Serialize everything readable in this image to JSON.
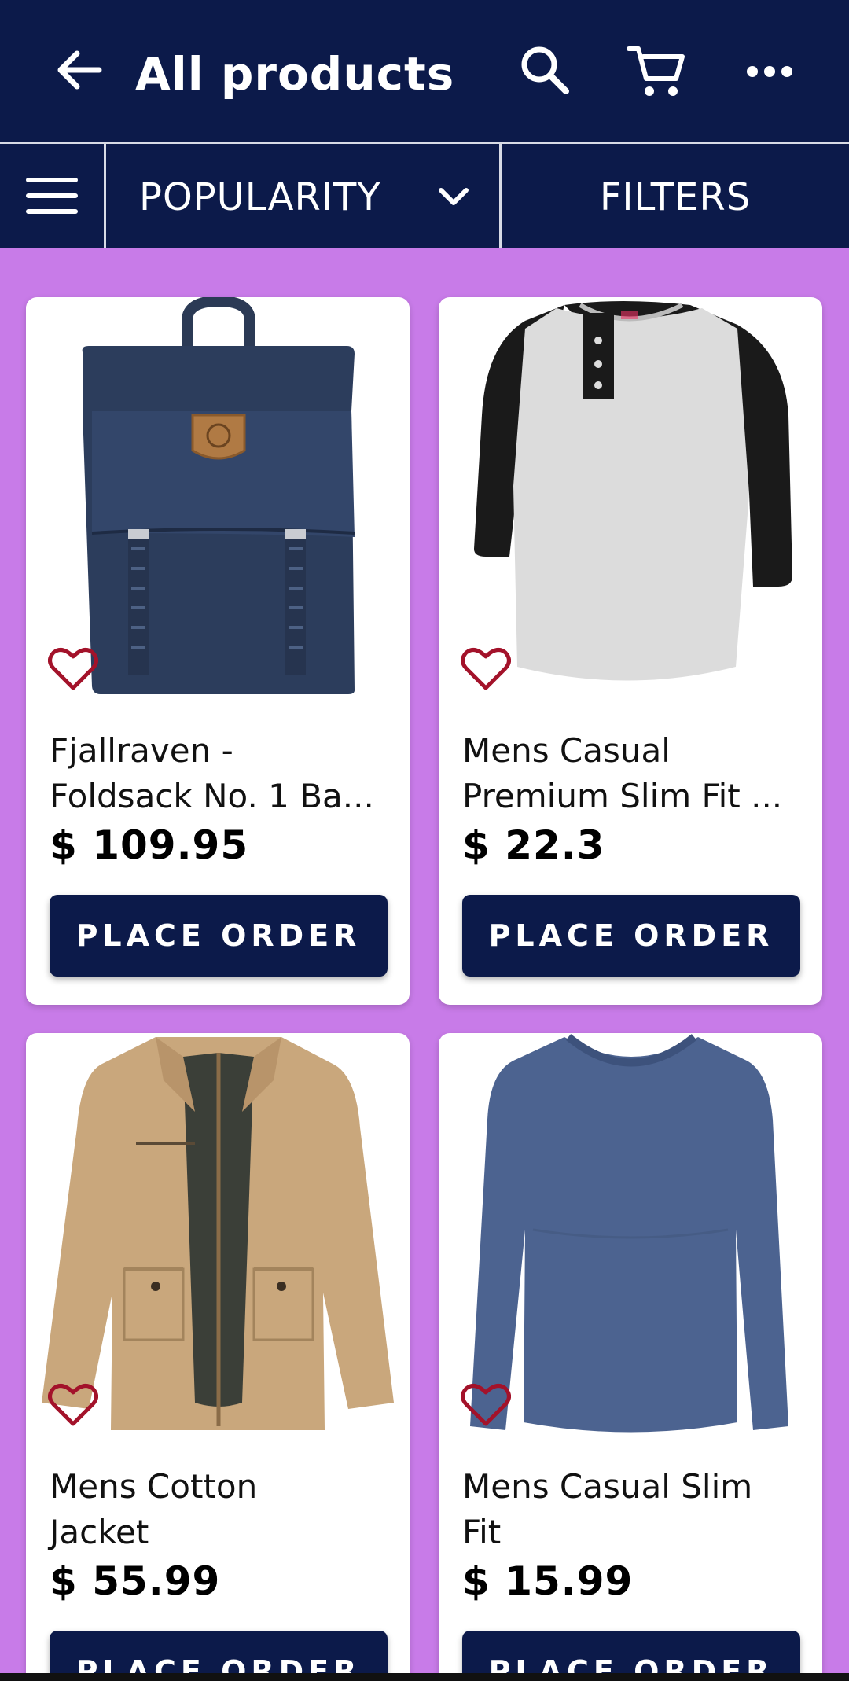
{
  "header": {
    "title": "All products",
    "back_icon": "arrow-left-icon",
    "search_icon": "search-icon",
    "cart_icon": "cart-icon",
    "more_icon": "more-horizontal-icon"
  },
  "toolbar": {
    "menu_icon": "hamburger-menu-icon",
    "sort_label": "POPULARITY",
    "sort_icon": "chevron-down-icon",
    "filters_label": "FILTERS"
  },
  "colors": {
    "primary": "#0c1a4a",
    "background": "#c87be8",
    "favorite": "#a3122a"
  },
  "products": [
    {
      "name": "Fjallraven -\nFoldsack No. 1 Ba...",
      "price": "$ 109.95",
      "button": "PLACE ORDER",
      "image": "navy-backpack"
    },
    {
      "name": "Mens Casual\nPremium Slim Fit ...",
      "price": "$ 22.3",
      "button": "PLACE ORDER",
      "image": "raglan-henley-shirt"
    },
    {
      "name": "Mens Cotton\nJacket",
      "price": "$ 55.99",
      "button": "PLACE ORDER",
      "image": "khaki-cotton-jacket"
    },
    {
      "name": "Mens Casual Slim\nFit",
      "price": "$ 15.99",
      "button": "PLACE ORDER",
      "image": "blue-long-sleeve-tee"
    }
  ]
}
